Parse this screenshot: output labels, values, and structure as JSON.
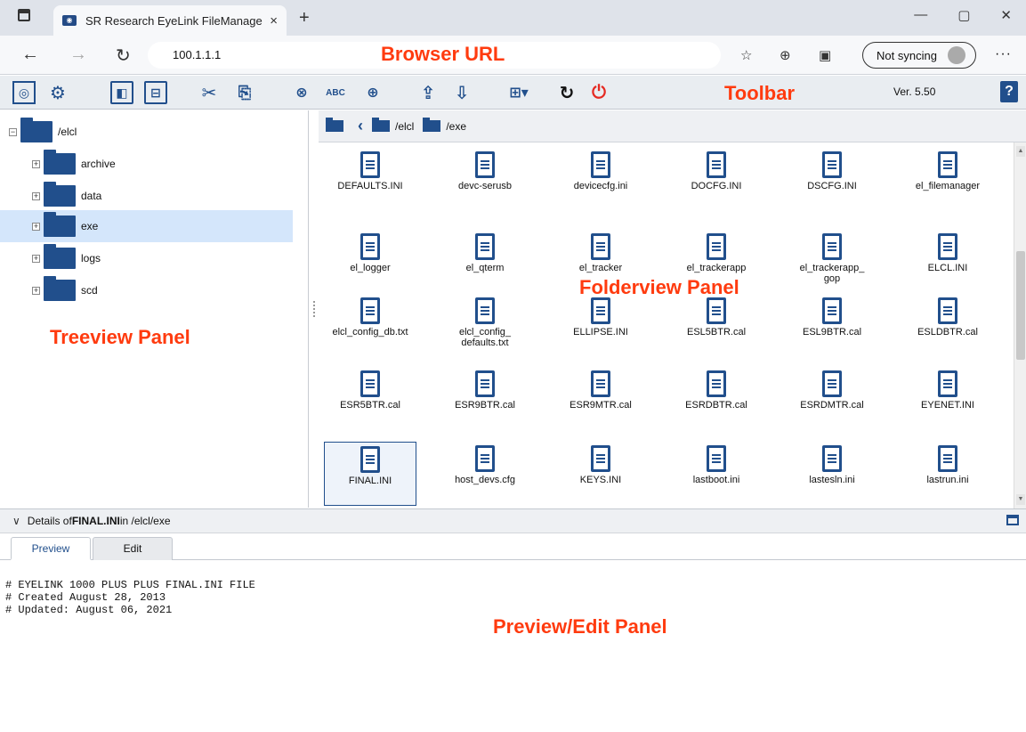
{
  "browser": {
    "tab_title": "SR Research EyeLink FileManage",
    "tab_close": "×",
    "new_tab": "+",
    "url": "100.1.1.1",
    "sync_label": "Not syncing",
    "menu": "···",
    "window_controls": [
      "—",
      "▢",
      "✕"
    ]
  },
  "annotations": {
    "browser_url": "Browser URL",
    "toolbar": "Toolbar",
    "treeview": "Treeview Panel",
    "folderview": "Folderview Panel",
    "preview": "Preview/Edit Panel"
  },
  "toolbar": {
    "version": "Ver. 5.50",
    "help": "?"
  },
  "tree": {
    "root": "/elcl",
    "children": [
      "archive",
      "data",
      "exe",
      "logs",
      "scd"
    ],
    "selected": "exe"
  },
  "breadcrumb": {
    "items": [
      "/elcl",
      "/exe"
    ]
  },
  "files": [
    {
      "name": "DEFAULTS.INI"
    },
    {
      "name": "devc-serusb"
    },
    {
      "name": "devicecfg.ini"
    },
    {
      "name": "DOCFG.INI"
    },
    {
      "name": "DSCFG.INI"
    },
    {
      "name": "el_filemanager"
    },
    {
      "name": "el_logger"
    },
    {
      "name": "el_qterm"
    },
    {
      "name": "el_tracker"
    },
    {
      "name": "el_trackerapp"
    },
    {
      "name": "el_trackerapp_\ngop"
    },
    {
      "name": "ELCL.INI"
    },
    {
      "name": "elcl_config_db.txt"
    },
    {
      "name": "elcl_config_\ndefaults.txt"
    },
    {
      "name": "ELLIPSE.INI"
    },
    {
      "name": "ESL5BTR.cal"
    },
    {
      "name": "ESL9BTR.cal"
    },
    {
      "name": "ESLDBTR.cal"
    },
    {
      "name": "ESR5BTR.cal"
    },
    {
      "name": "ESR9BTR.cal"
    },
    {
      "name": "ESR9MTR.cal"
    },
    {
      "name": "ESRDBTR.cal"
    },
    {
      "name": "ESRDMTR.cal"
    },
    {
      "name": "EYENET.INI"
    },
    {
      "name": "FINAL.INI"
    },
    {
      "name": "host_devs.cfg"
    },
    {
      "name": "KEYS.INI"
    },
    {
      "name": "lastboot.ini"
    },
    {
      "name": "lastesln.ini"
    },
    {
      "name": "lastrun.ini"
    }
  ],
  "selected_file": "FINAL.INI",
  "details": {
    "prefix": "Details of ",
    "file": "FINAL.INI",
    "suffix": " in /elcl/exe"
  },
  "preview_tabs": [
    "Preview",
    "Edit"
  ],
  "preview_lines": [
    "# EYELINK 1000 PLUS PLUS FINAL.INI FILE",
    "# Created August 28, 2013",
    "# Updated: August 06, 2021"
  ]
}
